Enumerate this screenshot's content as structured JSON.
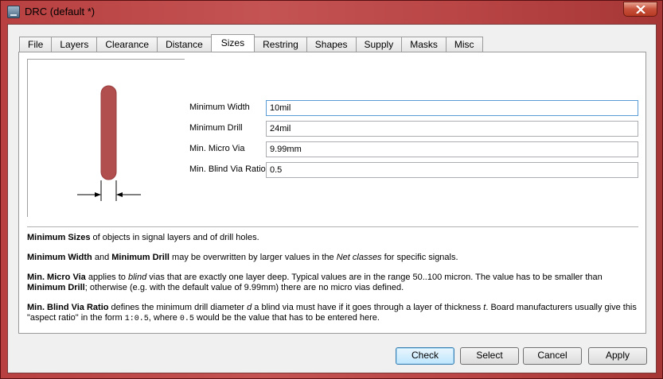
{
  "window": {
    "title": "DRC (default *)",
    "colors": {
      "titlebar": "#c45353",
      "client": "#f0f0f0",
      "trace": "#b14e4e"
    }
  },
  "tabs": [
    "File",
    "Layers",
    "Clearance",
    "Distance",
    "Sizes",
    "Restring",
    "Shapes",
    "Supply",
    "Masks",
    "Misc"
  ],
  "active_tab": "Sizes",
  "form": {
    "min_width": {
      "label": "Minimum Width",
      "value": "10mil"
    },
    "min_drill": {
      "label": "Minimum Drill",
      "value": "24mil"
    },
    "min_micro_via": {
      "label": "Min. Micro Via",
      "value": "9.99mm"
    },
    "min_blind_via_ratio": {
      "label": "Min. Blind Via Ratio",
      "value": "0.5"
    }
  },
  "help": {
    "p1": {
      "b1": "Minimum Sizes",
      "t1": " of objects in signal layers and of drill holes."
    },
    "p2": {
      "b1": "Minimum Width",
      "t1": " and ",
      "b2": "Minimum Drill",
      "t2": " may be overwritten by larger values in the ",
      "i1": "Net classes",
      "t3": " for specific signals."
    },
    "p3": {
      "b1": "Min. Micro Via",
      "t1": " applies to ",
      "i1": "blind",
      "t2": " vias that are exactly one layer deep. Typical values are in the range 50..100 micron. The value has to be smaller than ",
      "b2": "Minimum Drill",
      "t3": "; otherwise (e.g. with the default value of 9.99mm) there are no micro vias defined."
    },
    "p4": {
      "b1": "Min. Blind Via Ratio",
      "t1": " defines the minimum drill diameter ",
      "i1": "d",
      "t2": " a blind via must have if it goes through a layer of thickness ",
      "i2": "t",
      "t3": ". Board manufacturers usually give this \"aspect ratio\" in the form ",
      "m1": "1:0.5",
      "t4": ", where ",
      "m2": "0.5",
      "t5": " would be the value that has to be entered here."
    }
  },
  "buttons": {
    "check": "Check",
    "select": "Select",
    "cancel": "Cancel",
    "apply": "Apply"
  }
}
